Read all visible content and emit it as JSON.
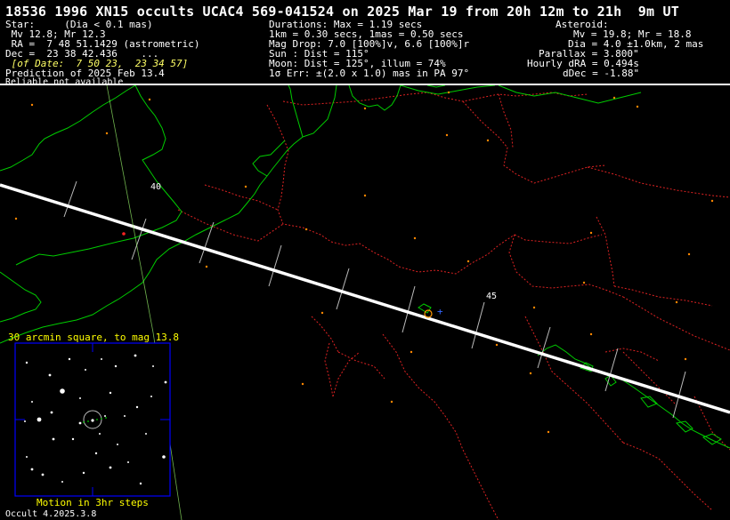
{
  "header": {
    "title": "18536 1996 XN15 occults UCAC4 569-041524 on 2025 Mar 19 from 20h 12m to 21h  9m UT",
    "star": {
      "l1": "Star:     (Dia < 0.1 mas)",
      "l2": " Mv 12.8; Mr 12.3",
      "l3": " RA =  7 48 51.1429 (astrometric)",
      "l4": "Dec =  23 38 42.436    ...",
      "l5": " [of Date:  7 50 23,  23 34 57]",
      "l6": "Prediction of 2025 Feb 13.4",
      "l7": "Reliable not available"
    },
    "event": {
      "l1": "Durations: Max = 1.19 secs",
      "l2": "1km = 0.30 secs, 1mas = 0.50 secs",
      "l3": "Mag Drop: 7.0 [100%]v, 6.6 [100%]r",
      "l4": "Sun : Dist = 115°",
      "l5": "Moon: Dist = 125°, illum = 74%",
      "l6": "1σ Err: ±(2.0 x 1.0) mas in PA 97°"
    },
    "asteroid": {
      "l1": "Asteroid:",
      "l2": "Mv = 19.8; Mr = 18.8",
      "l3": "Dia = 4.0 ±1.0km, 2 mas",
      "l4": "Parallax = 3.800\"",
      "l5": "Hourly dRA = 0.494s",
      "l6": "dDec = -1.88\""
    }
  },
  "map": {
    "time_labels": [
      "40",
      "45"
    ],
    "colors": {
      "coast": "#00cc00",
      "border": "#dd2222",
      "path": "#ffffff",
      "city": "#ff8800",
      "finder_frame": "#0000ff",
      "label_yellow": "#ffff00"
    }
  },
  "finder": {
    "title": "30 arcmin square, to mag 13.8",
    "caption": "Motion in 3hr steps"
  },
  "footer": {
    "version": "Occult 4.2025.3.8"
  }
}
